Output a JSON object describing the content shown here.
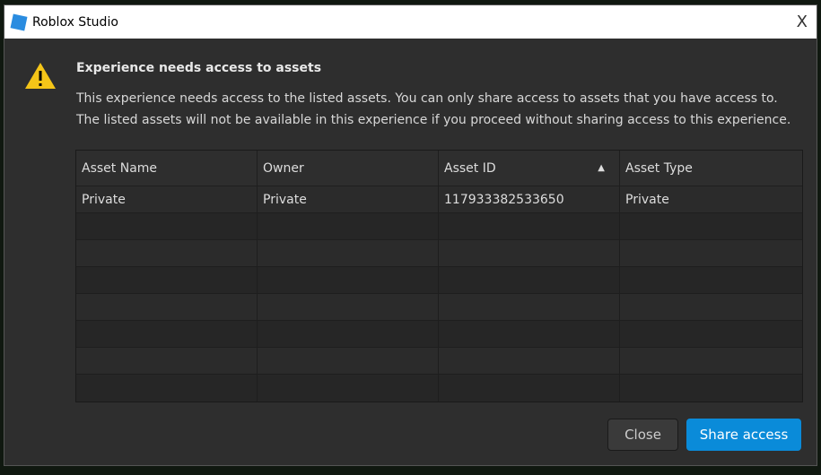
{
  "window": {
    "title": "Roblox Studio",
    "close_glyph": "X"
  },
  "dialog": {
    "heading": "Experience needs access to assets",
    "description": "This experience needs access to the listed assets. You can only share access to assets that you have access to. The listed assets will not be available in this experience if you proceed without sharing access to this experience."
  },
  "table": {
    "columns": [
      "Asset Name",
      "Owner",
      "Asset ID",
      "Asset Type"
    ],
    "sort_indicator": "▲",
    "rows": [
      [
        "Private",
        "Private",
        "117933382533650",
        "Private"
      ]
    ]
  },
  "buttons": {
    "close": "Close",
    "share": "Share access"
  },
  "colors": {
    "accent": "#0a8bd9",
    "warning": "#f5c518"
  }
}
